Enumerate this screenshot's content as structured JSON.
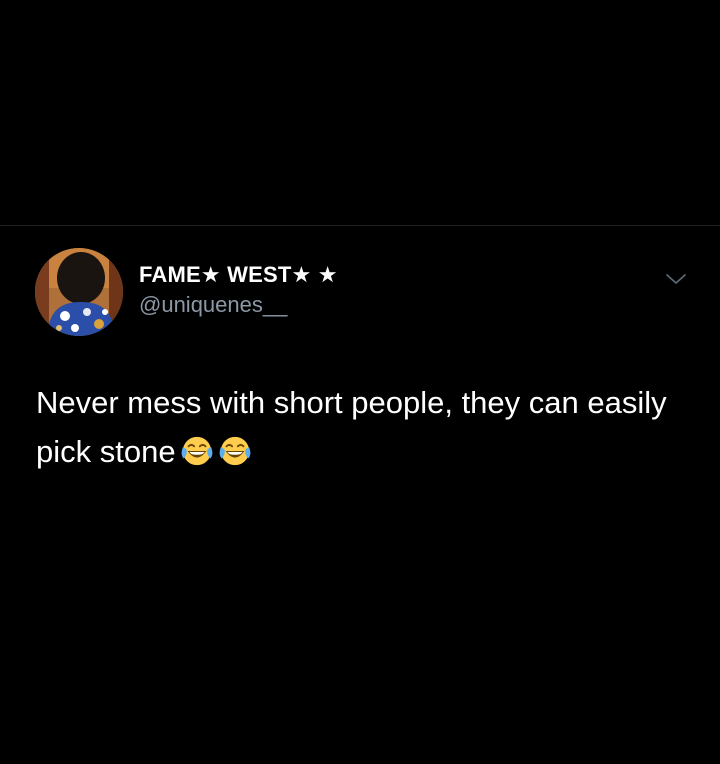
{
  "tweet": {
    "display_name": "FAME★ WEST★ ★",
    "handle": "@uniquenes__",
    "text": "Never mess with short people, they can easily pick stone",
    "emoji": [
      "face-with-tears-of-joy",
      "face-with-tears-of-joy"
    ]
  },
  "colors": {
    "background": "#000000",
    "primary_text": "#ffffff",
    "secondary_text": "#8b98a5",
    "divider": "#1c1f23"
  }
}
